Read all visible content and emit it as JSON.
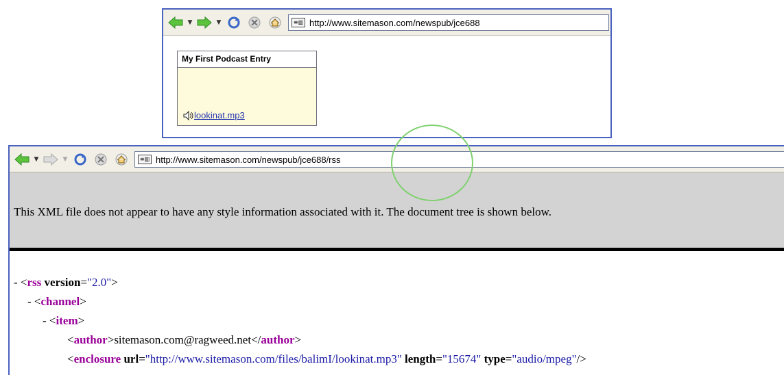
{
  "colors": {
    "window_border": "#4a62c0",
    "tag": "#990099",
    "value": "#1a1aa6",
    "highlight_circle": "#7fd16e",
    "banner": "#d3d3d3"
  },
  "window1": {
    "address": "http://www.sitemason.com/newspub/jce688",
    "entry_title": "My First Podcast Entry",
    "enclosure_link": "lookinat.mp3"
  },
  "window2": {
    "address": "http://www.sitemason.com/newspub/jce688/rss",
    "banner_text": "This XML file does not appear to have any style information associated with it. The document tree is shown below.",
    "tree": {
      "rss": {
        "toggle": "- ",
        "tag": "rss",
        "attr_name": "version",
        "attr_value": "\"2.0\""
      },
      "channel": {
        "toggle": "- ",
        "tag": "channel"
      },
      "item": {
        "toggle": "- ",
        "tag": "item"
      },
      "author": {
        "tag": "author",
        "text": "sitemason.com@ragweed.net"
      },
      "enclosure": {
        "tag": "enclosure",
        "url_name": "url",
        "url_value": "\"http://www.sitemason.com/files/balimI/lookinat.mp3\"",
        "length_name": "length",
        "length_value": "\"15674\"",
        "type_name": "type",
        "type_value": "\"audio/mpeg\""
      }
    }
  },
  "icons": {
    "back": "back-arrow-icon",
    "forward": "forward-arrow-icon",
    "refresh": "refresh-icon",
    "stop": "stop-icon",
    "home": "home-icon",
    "page": "page-icon",
    "speaker": "speaker-icon"
  }
}
